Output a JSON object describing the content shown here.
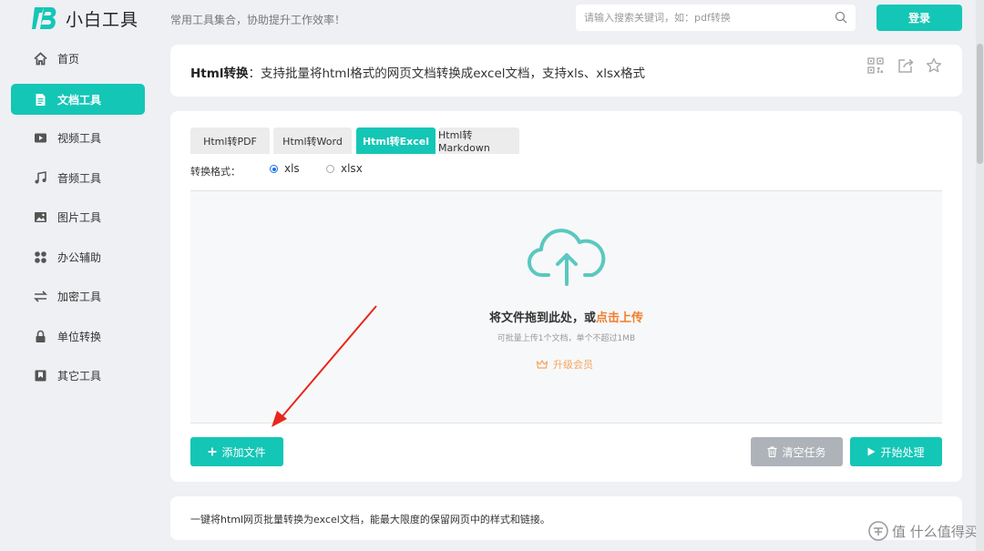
{
  "header": {
    "logo_text": "小白工具",
    "slogan": "常用工具集合，协助提升工作效率！",
    "search_placeholder": "请输入搜索关键词，如：pdf转换",
    "login_label": "登录"
  },
  "sidebar": {
    "items": [
      {
        "label": "首页",
        "icon": "home-icon",
        "active": false
      },
      {
        "label": "文档工具",
        "icon": "document-icon",
        "active": true
      },
      {
        "label": "视频工具",
        "icon": "video-icon",
        "active": false
      },
      {
        "label": "音频工具",
        "icon": "music-icon",
        "active": false
      },
      {
        "label": "图片工具",
        "icon": "image-icon",
        "active": false
      },
      {
        "label": "办公辅助",
        "icon": "office-icon",
        "active": false
      },
      {
        "label": "加密工具",
        "icon": "exchange-icon",
        "active": false
      },
      {
        "label": "单位转换",
        "icon": "lock-icon",
        "active": false
      },
      {
        "label": "其它工具",
        "icon": "bookmark-icon",
        "active": false
      }
    ]
  },
  "title": {
    "name": "Html转换",
    "description": "：支持批量将html格式的网页文档转换成excel文档，支持xls、xlsx格式"
  },
  "tabs": [
    {
      "label": "Html转PDF",
      "active": false
    },
    {
      "label": "Html转Word",
      "active": false
    },
    {
      "label": "Html转Excel",
      "active": true
    },
    {
      "label": "Html转Markdown",
      "active": false
    }
  ],
  "format": {
    "label": "转换格式：",
    "options": [
      "xls",
      "xlsx"
    ],
    "selected": "xls"
  },
  "upload": {
    "title_prefix": "将文件拖到此处，或",
    "title_link": "点击上传",
    "hint": "可批量上传1个文档，单个不超过1MB",
    "vip_label": "升级会员"
  },
  "buttons": {
    "add_file": "添加文件",
    "clear_tasks": "清空任务",
    "start": "开始处理"
  },
  "description": "一键将html网页批量转换为excel文档，能最大限度的保留网页中的样式和链接。",
  "watermark": "值 什么值得买",
  "colors": {
    "accent": "#14c6b6",
    "highlight": "#f27d2b",
    "vip": "#f4a562",
    "annotation_arrow": "#e8261c"
  }
}
